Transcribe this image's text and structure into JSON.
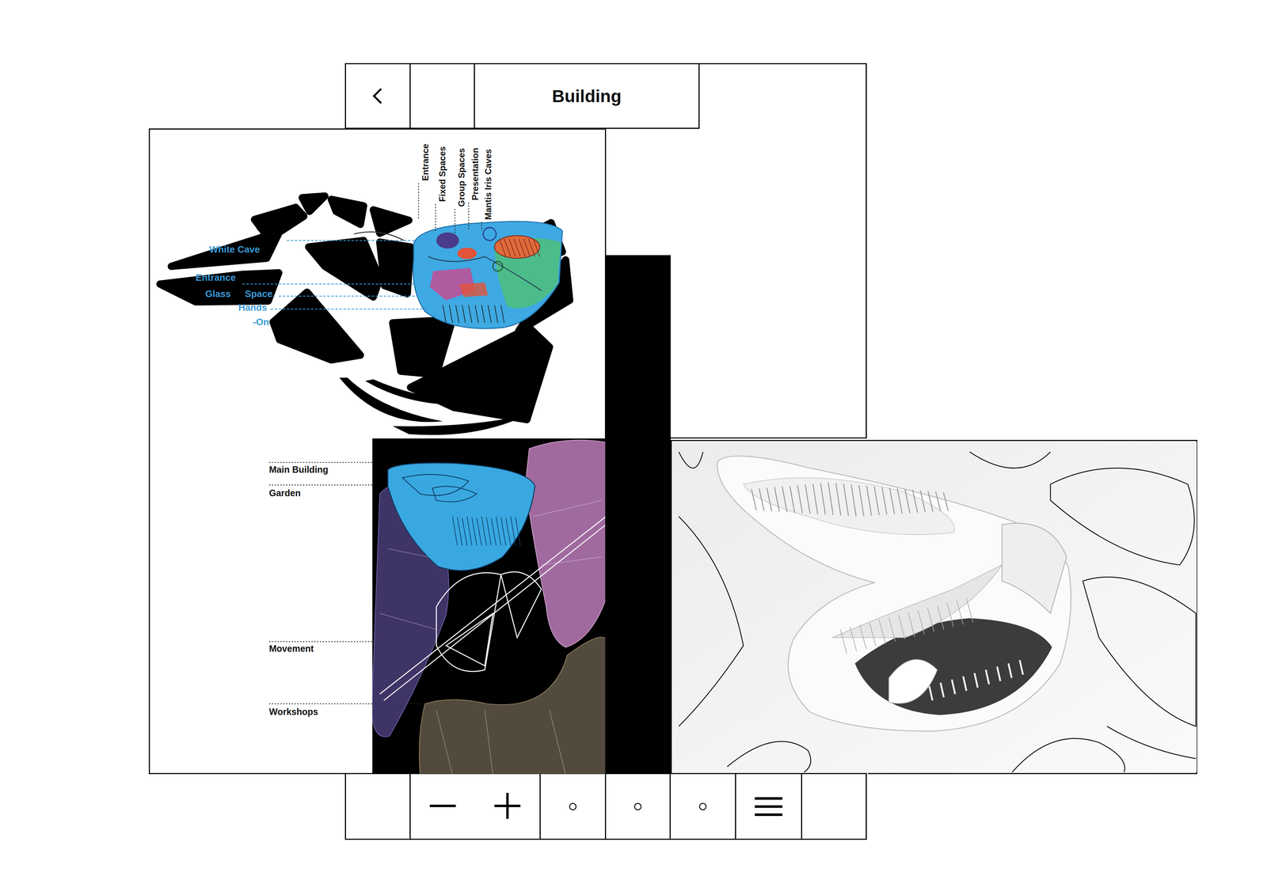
{
  "header": {
    "title": "Building"
  },
  "program_labels": [
    "Entrance",
    "Fixed Spaces",
    "Group Spaces",
    "Presentation",
    "Mantis Iris Caves"
  ],
  "space_labels": [
    "White Cave",
    "Entrance",
    "Glass",
    "Space.",
    "Hands",
    "-On"
  ],
  "zone_labels": [
    "Main Building",
    "Garden",
    "Movement",
    "Workshops"
  ]
}
